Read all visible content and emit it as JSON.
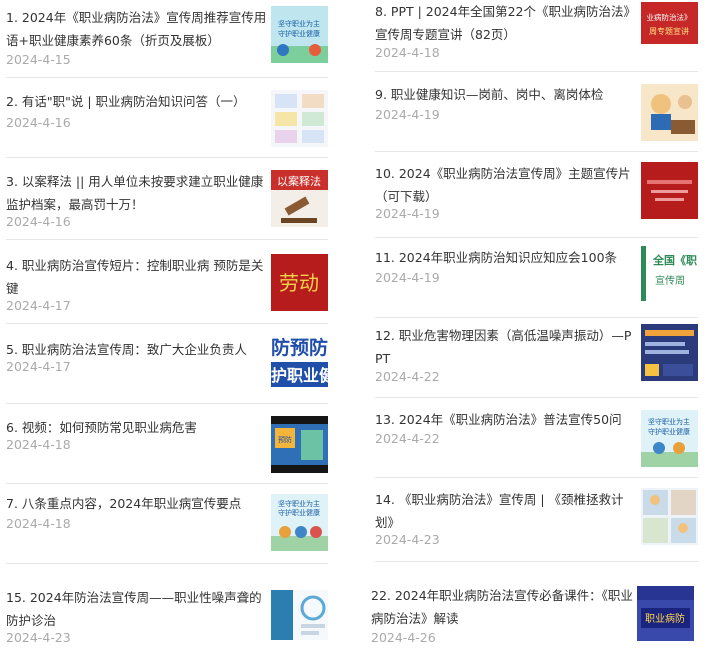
{
  "items": [
    {
      "title": "1. 2024年《职业病防治法》宣传周推荐宣传用语+职业健康素养60条（折页及展板）",
      "date": "2024-4-15"
    },
    {
      "title": "2. 有话\"职\"说 | 职业病防治知识问答（一）",
      "date": "2024-4-16"
    },
    {
      "title": "3. 以案释法 || 用人单位未按要求建立职业健康监护档案，最高罚十万！",
      "date": "2024-4-16"
    },
    {
      "title": "4. 职业病防治宣传短片：控制职业病 预防是关键",
      "date": "2024-4-17"
    },
    {
      "title": "5. 职业病防治法宣传周：致广大企业负责人",
      "date": "2024-4-17"
    },
    {
      "title": "6. 视频：如何预防常见职业病危害",
      "date": "2024-4-18"
    },
    {
      "title": "7. 八条重点内容，2024年职业病宣传要点",
      "date": "2024-4-18"
    },
    {
      "title": "15. 2024年防治法宣传周——职业性噪声聋的防护诊治",
      "date": "2024-4-23"
    },
    {
      "title": "8. PPT | 2024年全国第22个《职业病防治法》宣传周专题宣讲（82页）",
      "date": "2024-4-18"
    },
    {
      "title": "9. 职业健康知识—岗前、岗中、离岗体检",
      "date": "2024-4-19"
    },
    {
      "title": "10. 2024《职业病防治法宣传周》主题宣传片（可下载）",
      "date": "2024-4-19"
    },
    {
      "title": "11. 2024年职业病防治知识应知应会100条",
      "date": "2024-4-19"
    },
    {
      "title": "12. 职业危害物理因素（高低温噪声振动）—PPT",
      "date": "2024-4-22"
    },
    {
      "title": "13. 2024年《职业病防治法》普法宣传50问",
      "date": "2024-4-22"
    },
    {
      "title": "14. 《职业病防治法》宣传周 | 《颈椎拯救计划》",
      "date": "2024-4-23"
    },
    {
      "title": "22. 2024年职业病防治法宣传必备课件：《职业病防治法》解读",
      "date": "2024-4-26"
    }
  ],
  "thumb_text": {
    "t1": "坚守职业为主\n守护职业健康",
    "t3": "以案释法",
    "t4": "劳动",
    "t5a": "防预防",
    "t5b": "护职业健",
    "t6": "预防",
    "t7": "坚守职业为主\n守护职业健康",
    "t8a": "业病防治法》",
    "t8b": "周专题宣讲",
    "t11a": "全国《职",
    "t11b": "宣传周",
    "t13": "坚守职业为主\n守护职业健康",
    "t22": "职业病防"
  }
}
